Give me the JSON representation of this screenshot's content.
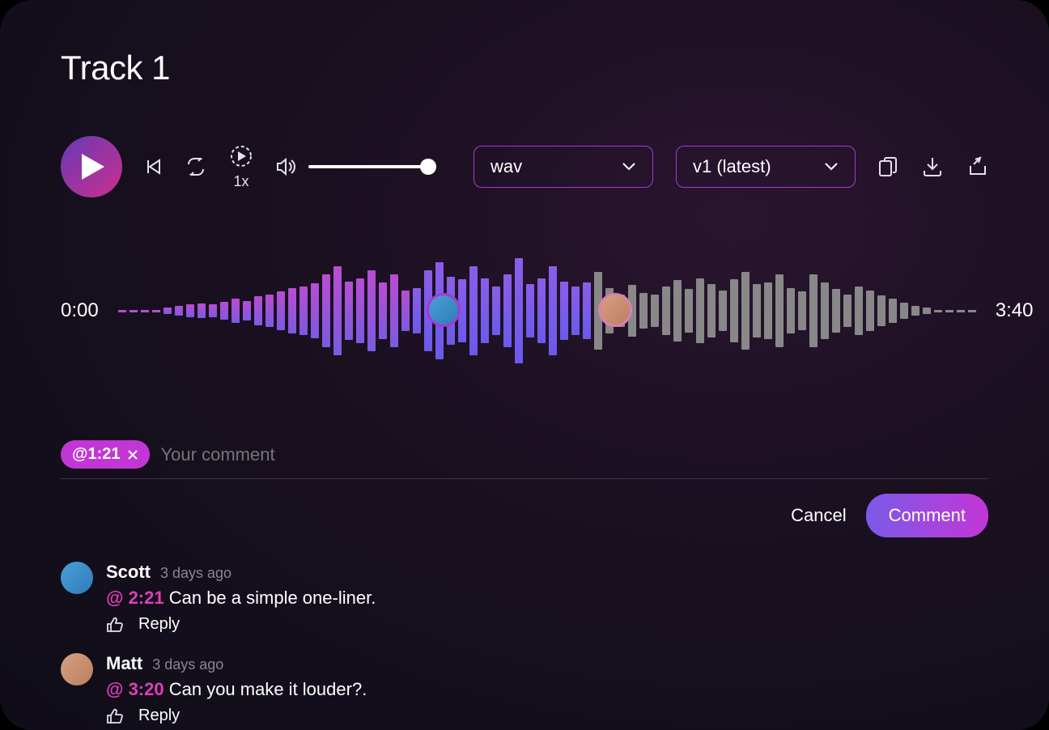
{
  "title": "Track 1",
  "controls": {
    "speed": "1x",
    "format": "wav",
    "version": "v1 (latest)"
  },
  "waveform": {
    "start": "0:00",
    "end": "3:40"
  },
  "input": {
    "timestamp": "@1:21",
    "placeholder": "Your comment",
    "cancel": "Cancel",
    "submit": "Comment"
  },
  "comments": [
    {
      "author": "Scott",
      "ago": "3 days ago",
      "ts": "@ 2:21",
      "text": "Can be a simple one-liner.",
      "reply": "Reply"
    },
    {
      "author": "Matt",
      "ago": "3 days ago",
      "ts": "@ 3:20",
      "text": "Can you make it louder?.",
      "reply": "Reply"
    }
  ]
}
